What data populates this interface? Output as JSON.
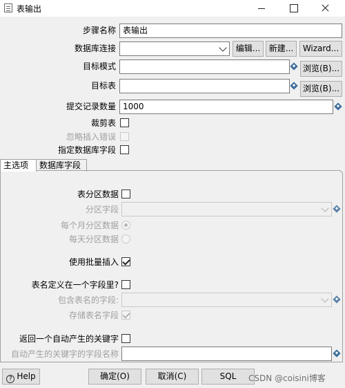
{
  "window": {
    "title": "表输出"
  },
  "fields": {
    "step_name": {
      "label": "步骤名称",
      "value": "表输出"
    },
    "connection": {
      "label": "数据库连接",
      "value": "",
      "edit_btn": "编辑...",
      "new_btn": "新建...",
      "wizard_btn": "Wizard..."
    },
    "target_schema": {
      "label": "目标模式",
      "value": "",
      "browse_btn": "浏览(B)..."
    },
    "target_table": {
      "label": "目标表",
      "value": "",
      "browse_btn": "浏览(B)..."
    },
    "commit_size": {
      "label": "提交记录数量",
      "value": "1000"
    },
    "truncate_table": {
      "label": "裁剪表",
      "checked": false
    },
    "ignore_insert_errors": {
      "label": "忽略插入错误",
      "checked": false,
      "disabled": true
    },
    "specify_fields": {
      "label": "指定数据库字段",
      "checked": false
    }
  },
  "tabs": [
    {
      "label": "主选项",
      "active": true
    },
    {
      "label": "数据库字段",
      "active": false
    }
  ],
  "main_tab": {
    "partition_data": {
      "label": "表分区数据",
      "checked": false
    },
    "partition_field": {
      "label": "分区字段",
      "value": ""
    },
    "partition_monthly": {
      "label": "每个月分区数据",
      "selected": true
    },
    "partition_daily": {
      "label": "每天分区数据",
      "selected": false
    },
    "batch_insert": {
      "label": "使用批量插入",
      "checked": true
    },
    "tablename_in_field": {
      "label": "表名定义在一个字段里?",
      "checked": false
    },
    "tablename_field": {
      "label": "包含表名的字段:",
      "value": ""
    },
    "store_tablename": {
      "label": "存储表名字段",
      "checked": true
    },
    "return_key": {
      "label": "返回一个自动产生的关键字",
      "checked": false
    },
    "key_field_name": {
      "label": "自动产生的关键字的字段名称",
      "value": ""
    }
  },
  "footer": {
    "help": "Help",
    "ok": "确定(O)",
    "cancel": "取消(C)",
    "sql": "SQL",
    "watermark": "CSDN @coisini博客"
  }
}
